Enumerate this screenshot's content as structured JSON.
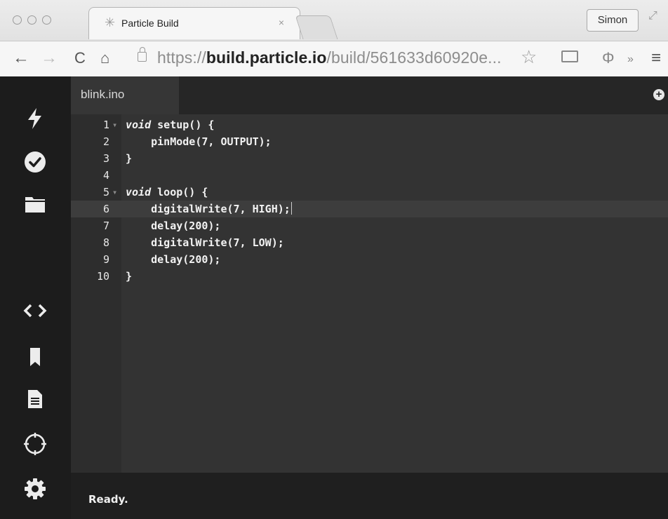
{
  "browser": {
    "tab_title": "Particle Build",
    "tab_close": "×",
    "profile_name": "Simon",
    "url_scheme": "https://",
    "url_host": "build.particle.io",
    "url_path": "/build/561633d60920e...",
    "icons": [
      "back-icon",
      "forward-icon",
      "reload-icon",
      "home-icon",
      "lock-icon",
      "star-icon",
      "cast-icon",
      "extension-icon",
      "overflow-icon",
      "menu-icon"
    ]
  },
  "sidebar": {
    "items": [
      "flash-icon",
      "verify-icon",
      "folder-icon",
      "code-icon",
      "libraries-icon",
      "docs-icon",
      "devices-icon",
      "settings-icon"
    ]
  },
  "editor": {
    "file_tab": "blink.ino",
    "lines": [
      {
        "num": "1",
        "fold": "▾",
        "keyword": "void",
        "rest": " setup() {"
      },
      {
        "num": "2",
        "fold": "",
        "keyword": "",
        "rest": "    pinMode(7, OUTPUT);"
      },
      {
        "num": "3",
        "fold": "",
        "keyword": "",
        "rest": "}"
      },
      {
        "num": "4",
        "fold": "",
        "keyword": "",
        "rest": ""
      },
      {
        "num": "5",
        "fold": "▾",
        "keyword": "void",
        "rest": " loop() {"
      },
      {
        "num": "6",
        "fold": "",
        "keyword": "",
        "rest": "    digitalWrite(7, HIGH);"
      },
      {
        "num": "7",
        "fold": "",
        "keyword": "",
        "rest": "    delay(200);"
      },
      {
        "num": "8",
        "fold": "",
        "keyword": "",
        "rest": "    digitalWrite(7, LOW);"
      },
      {
        "num": "9",
        "fold": "",
        "keyword": "",
        "rest": "    delay(200);"
      },
      {
        "num": "10",
        "fold": "",
        "keyword": "",
        "rest": "}"
      }
    ]
  },
  "status": {
    "text": "Ready."
  }
}
